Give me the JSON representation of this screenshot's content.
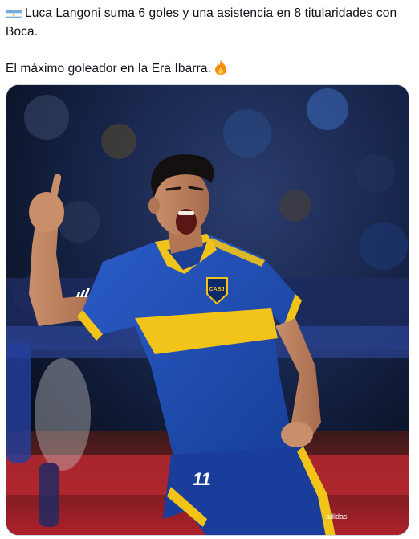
{
  "tweet": {
    "line1": "Luca Langoni suma 6 goles y una asistencia en 8 titularidades con Boca.",
    "line2": "El máximo goleador en la Era Ibarra.",
    "flag_icon": "argentina-flag-icon",
    "fire_icon": "fire-emoji-icon"
  },
  "photo": {
    "kit_crest": "CABJ",
    "shorts_number": "11",
    "sponsor": "adidas",
    "colors": {
      "kit_blue": "#1f4fb8",
      "kit_yellow": "#f2c318"
    }
  }
}
